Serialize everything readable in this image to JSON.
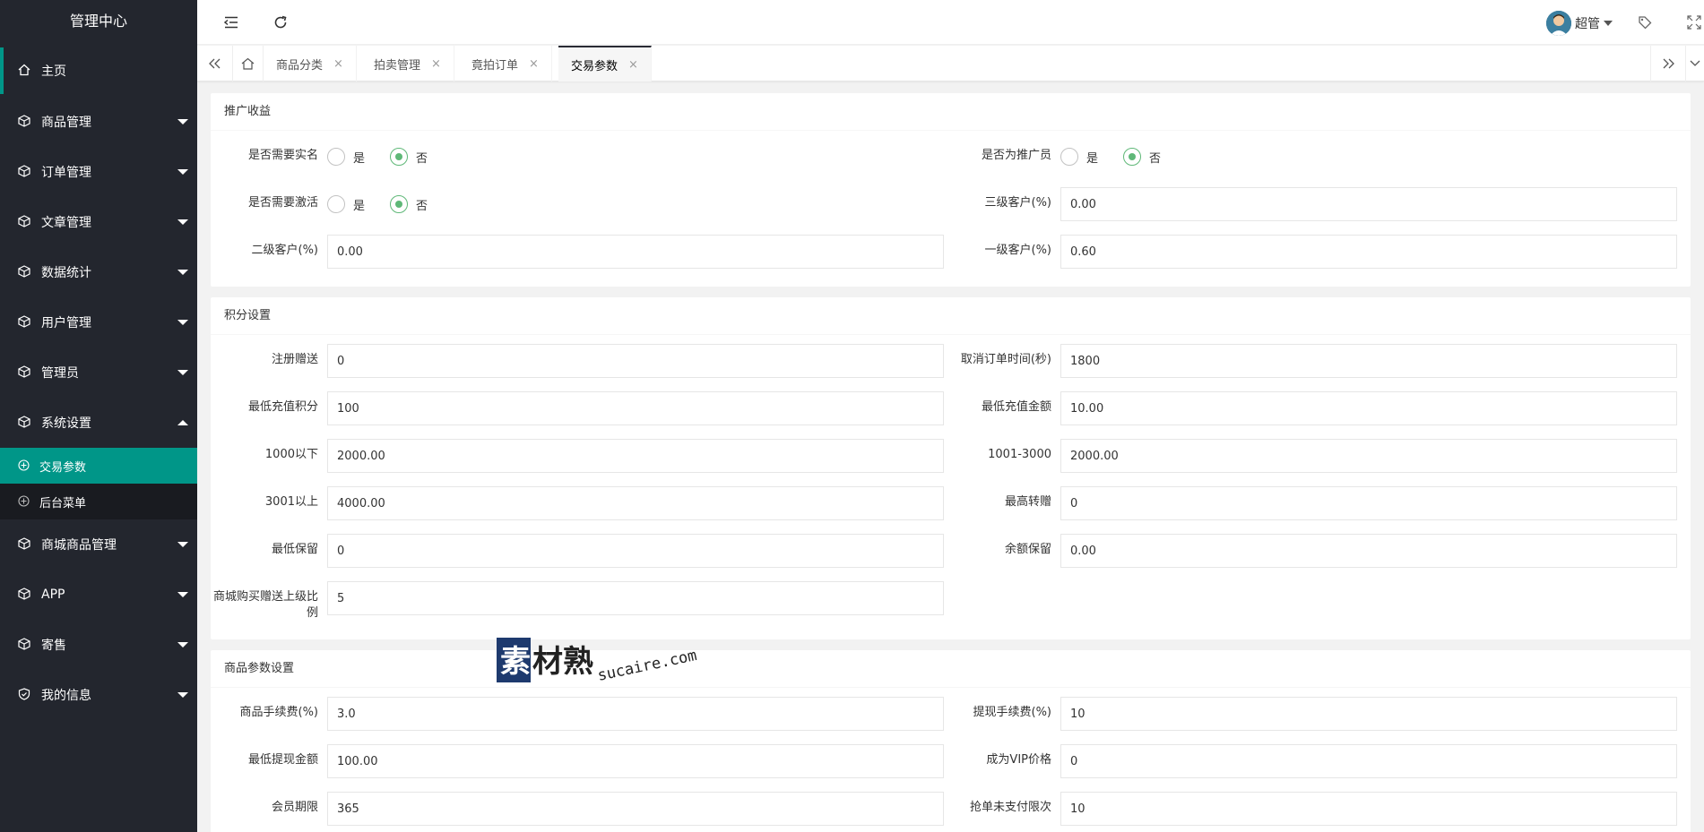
{
  "sidebar": {
    "title": "管理中心",
    "items": [
      {
        "label": "主页"
      },
      {
        "label": "商品管理"
      },
      {
        "label": "订单管理"
      },
      {
        "label": "文章管理"
      },
      {
        "label": "数据统计"
      },
      {
        "label": "用户管理"
      },
      {
        "label": "管理员"
      },
      {
        "label": "系统设置"
      },
      {
        "label": "商城商品管理"
      },
      {
        "label": "APP"
      },
      {
        "label": "寄售"
      },
      {
        "label": "我的信息"
      }
    ],
    "subitems": [
      {
        "label": "交易参数"
      },
      {
        "label": "后台菜单"
      }
    ]
  },
  "header": {
    "user_name": "超管"
  },
  "tabs": [
    {
      "label": "商品分类"
    },
    {
      "label": "拍卖管理"
    },
    {
      "label": "竟拍订单"
    },
    {
      "label": "交易参数"
    }
  ],
  "tab_close": "×",
  "sections": {
    "promo": {
      "title": "推广收益",
      "real_name_label": "是否需要实名",
      "promoter_label": "是否为推广员",
      "activate_label": "是否需要激活",
      "yes": "是",
      "no": "否",
      "level3_label": "三级客户(%)",
      "level3_value": "0.00",
      "level2_label": "二级客户(%)",
      "level2_value": "0.00",
      "level1_label": "一级客户(%)",
      "level1_value": "0.60"
    },
    "points": {
      "title": "积分设置",
      "register_label": "注册赠送",
      "register_value": "0",
      "cancel_label": "取消订单时间(秒)",
      "cancel_value": "1800",
      "min_points_label": "最低充值积分",
      "min_points_value": "100",
      "min_amount_label": "最低充值金额",
      "min_amount_value": "10.00",
      "below1000_label": "1000以下",
      "below1000_value": "2000.00",
      "r1001_label": "1001-3000",
      "r1001_value": "2000.00",
      "above3001_label": "3001以上",
      "above3001_value": "4000.00",
      "max_transfer_label": "最高转赠",
      "max_transfer_value": "0",
      "min_reserve_label": "最低保留",
      "min_reserve_value": "0",
      "balance_reserve_label": "余额保留",
      "balance_reserve_value": "0.00",
      "mall_ratio_label": "商城购买赠送上级比例",
      "mall_ratio_value": "5"
    },
    "goods": {
      "title": "商品参数设置",
      "fee_label": "商品手续费(%)",
      "fee_value": "3.0",
      "withdraw_fee_label": "提现手续费(%)",
      "withdraw_fee_value": "10",
      "min_withdraw_label": "最低提现金额",
      "min_withdraw_value": "100.00",
      "vip_price_label": "成为VIP价格",
      "vip_price_value": "0",
      "member_term_label": "会员期限",
      "member_term_value": "365",
      "unpaid_limit_label": "抢单未支付限次",
      "unpaid_limit_value": "10"
    }
  },
  "watermark": {
    "cn": "素材熟",
    "en": "sucaire.com"
  },
  "colors": {
    "sidebar_bg": "#23262e",
    "accent": "#009688",
    "radio_checked": "#5fb878"
  }
}
